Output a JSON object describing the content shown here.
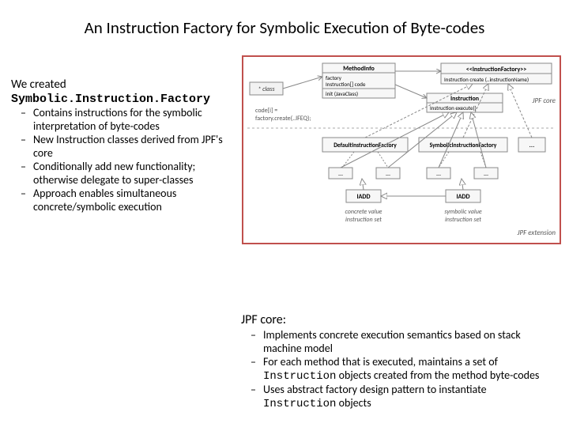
{
  "title": "An Instruction Factory for Symbolic Execution of Byte-codes",
  "left": {
    "intro": "We created",
    "class_name": "Symbolic.Instruction.Factory",
    "bullets": [
      "Contains instructions for the symbolic interpretation of byte-codes",
      "New Instruction classes derived from JPF's core",
      "Conditionally add new functionality; otherwise delegate to super-classes",
      "Approach enables simultaneous concrete/symbolic execution"
    ]
  },
  "diagram": {
    "class_box": "* class",
    "methodinfo": {
      "title": "MethodInfo",
      "line1": "factory",
      "line2": "Instruction[] code",
      "line3": "init (JavaClass)"
    },
    "code_snippet_l1": "code[i] =",
    "code_snippet_l2": "  factory.create(..IFEQ);",
    "instruction_factory": {
      "title": "<<InstructionFactory>>",
      "line1": "Instruction create (..instructionName)"
    },
    "instruction": {
      "title": "Instruction",
      "line1": "Instruction execute()"
    },
    "default_factory": "DefaultInstructionFactory",
    "symbolic_factory": "SymbolicInstructionFactory",
    "ellipsis": "…",
    "iadd": "IADD",
    "jpf_core_label": "JPF core",
    "jpf_ext_label": "JPF extension",
    "concrete_label_l1": "concrete value",
    "concrete_label_l2": "instruction set",
    "symbolic_label_l1": "symbolic value",
    "symbolic_label_l2": "instruction set"
  },
  "lower": {
    "title": "JPF core:",
    "b1": "Implements concrete execution semantics based on stack machine model",
    "b2_pre": "For each method that is executed, maintains a set of ",
    "b2_code": "Instruction",
    "b2_post": " objects created from the method byte-codes",
    "b3_pre": "Uses abstract factory design pattern to instantiate ",
    "b3_code": "Instruction",
    "b3_post": " objects"
  }
}
